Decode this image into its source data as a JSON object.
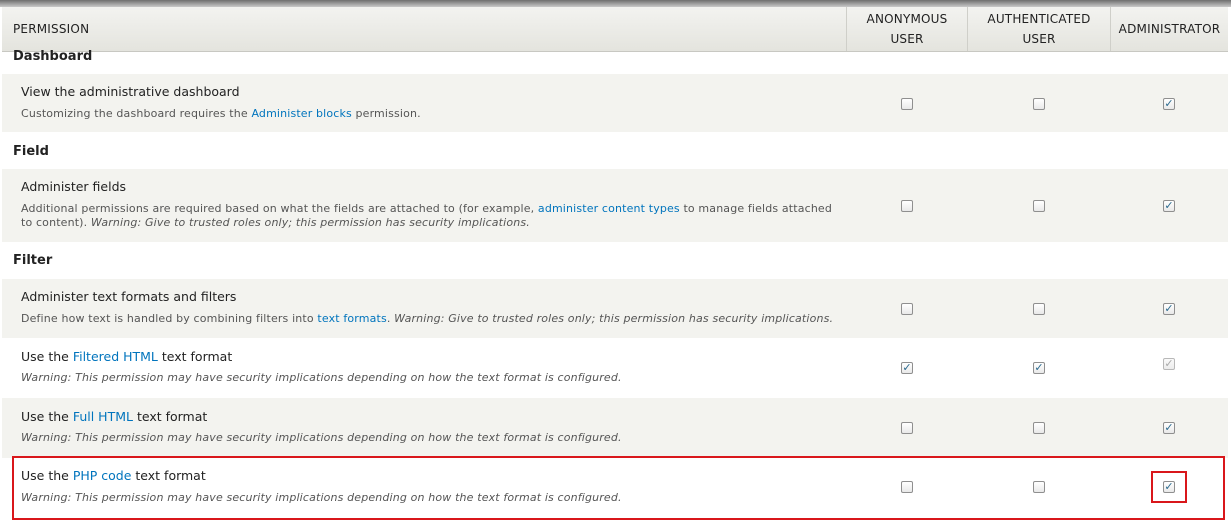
{
  "header": {
    "permission": "PERMISSION",
    "anonymous_line1": "ANONYMOUS",
    "anonymous_line2": "USER",
    "authenticated_line1": "AUTHENTICATED",
    "authenticated_line2": "USER",
    "administrator": "ADMINISTRATOR"
  },
  "modules": {
    "dashboard": "Dashboard",
    "field": "Field",
    "filter": "Filter"
  },
  "rows": {
    "dashboard_view": {
      "title": "View the administrative dashboard",
      "desc_pre": "Customizing the dashboard requires the ",
      "desc_link": "Administer blocks",
      "desc_post": " permission.",
      "anonymous": false,
      "authenticated": false,
      "administrator": true
    },
    "field_admin": {
      "title": "Administer fields",
      "desc_pre": "Additional permissions are required based on what the fields are attached to (for example, ",
      "desc_link": "administer content types",
      "desc_post": " to manage fields attached to content). ",
      "warning": "Warning: Give to trusted roles only; this permission has security implications.",
      "anonymous": false,
      "authenticated": false,
      "administrator": true
    },
    "filter_admin": {
      "title": "Administer text formats and filters",
      "desc_pre": "Define how text is handled by combining filters into ",
      "desc_link": "text formats",
      "desc_post": ". ",
      "warning": "Warning: Give to trusted roles only; this permission has security implications.",
      "anonymous": false,
      "authenticated": false,
      "administrator": true
    },
    "filtered_html": {
      "title_pre": "Use the ",
      "title_link": "Filtered HTML",
      "title_post": " text format",
      "warning": "Warning: This permission may have security implications depending on how the text format is configured.",
      "anonymous": true,
      "authenticated": true,
      "administrator": true,
      "administrator_disabled": true
    },
    "full_html": {
      "title_pre": "Use the ",
      "title_link": "Full HTML",
      "title_post": " text format",
      "warning": "Warning: This permission may have security implications depending on how the text format is configured.",
      "anonymous": false,
      "authenticated": false,
      "administrator": true
    },
    "php_code": {
      "title_pre": "Use the ",
      "title_link": "PHP code",
      "title_post": " text format",
      "warning": "Warning: This permission may have security implications depending on how the text format is configured.",
      "anonymous": false,
      "authenticated": false,
      "administrator": true
    }
  },
  "colors": {
    "link": "#0074bd",
    "highlight": "#d9171b",
    "row_shade": "#f3f3ef"
  },
  "icons": {
    "checked": "check-icon"
  }
}
